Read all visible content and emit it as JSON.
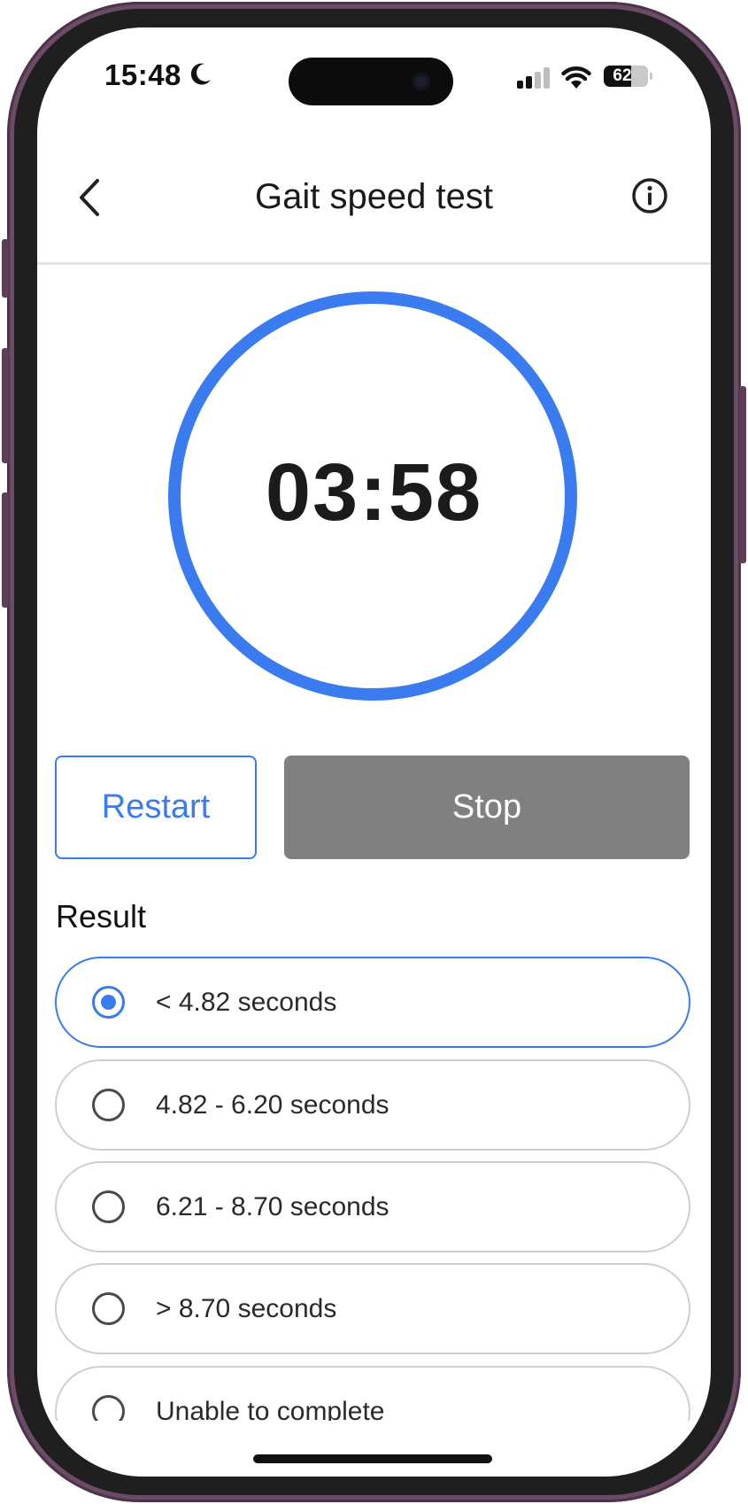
{
  "status_bar": {
    "time": "15:48",
    "battery": "62"
  },
  "header": {
    "title": "Gait speed test"
  },
  "timer": {
    "value": "03:58"
  },
  "actions": {
    "restart_label": "Restart",
    "stop_label": "Stop"
  },
  "result": {
    "heading": "Result",
    "options": [
      {
        "label": "< 4.82 seconds",
        "selected": true
      },
      {
        "label": "4.82 - 6.20 seconds",
        "selected": false
      },
      {
        "label": "6.21 - 8.70 seconds",
        "selected": false
      },
      {
        "label": "> 8.70 seconds",
        "selected": false
      },
      {
        "label": "Unable to complete",
        "selected": false
      }
    ]
  },
  "colors": {
    "accent": "#3a7cef",
    "stop_button": "#808080",
    "frame": "#6b4b66"
  },
  "icons": {
    "back": "chevron-left-icon",
    "info": "info-circle-icon",
    "status": [
      "moon-icon",
      "signal-icon",
      "wifi-icon",
      "battery-icon"
    ]
  }
}
